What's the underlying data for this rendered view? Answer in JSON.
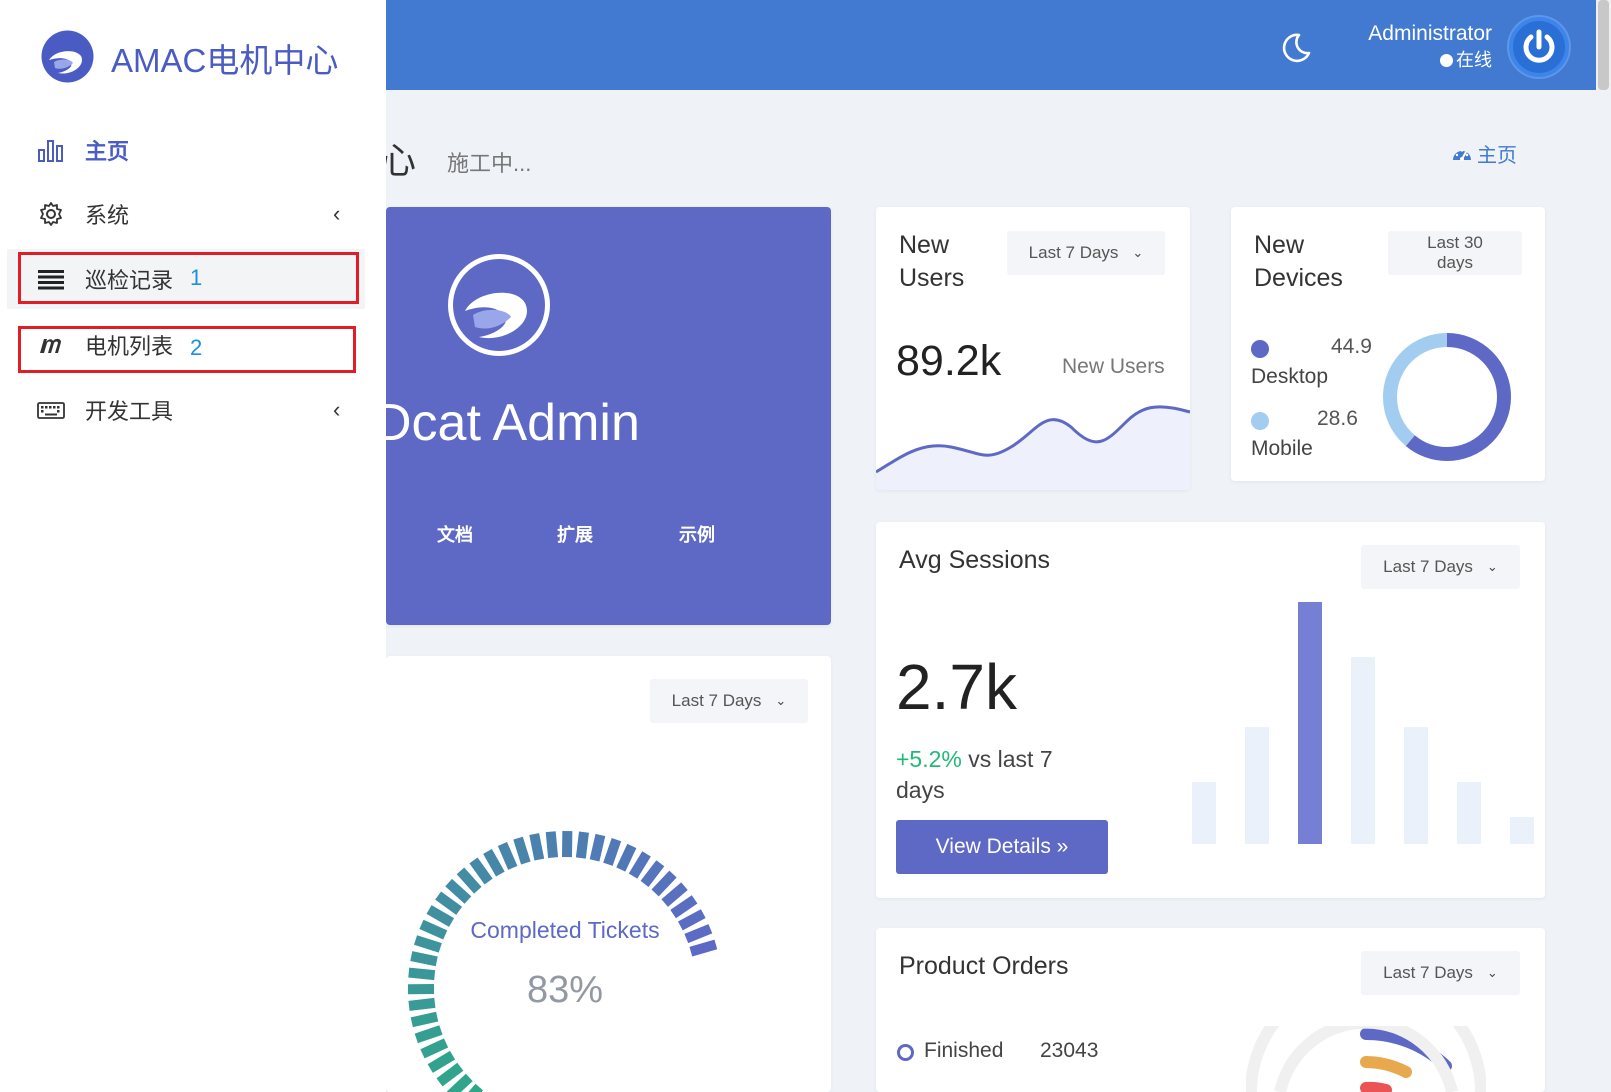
{
  "brand": {
    "name": "AMAC电机中心"
  },
  "header": {
    "user_name": "Administrator",
    "user_status": "在线"
  },
  "content": {
    "title": "心",
    "subtitle": "施工中...",
    "breadcrumb": "主页"
  },
  "sidebar": {
    "items": [
      {
        "label": "主页",
        "icon": "bar-chart-icon",
        "active": true
      },
      {
        "label": "系统",
        "icon": "gear-icon",
        "has_children": true
      },
      {
        "label": "巡检记录",
        "icon": "list-icon"
      },
      {
        "label": "电机列表",
        "icon": "m-icon"
      },
      {
        "label": "开发工具",
        "icon": "keyboard-icon",
        "has_children": true
      }
    ],
    "annotations": [
      "1",
      "2"
    ]
  },
  "hero": {
    "title": "Dcat Admin",
    "links": [
      "文档",
      "扩展",
      "示例"
    ]
  },
  "new_users": {
    "title": "New Users",
    "range": "Last 7 Days",
    "value": "89.2k",
    "caption": "New Users"
  },
  "new_devices": {
    "title": "New Devices",
    "range": "Last 30 days",
    "segments": [
      {
        "name": "Desktop",
        "value": 44.9,
        "color": "#5d69c5"
      },
      {
        "name": "Mobile",
        "value": 28.6,
        "color": "#a3cdf0"
      }
    ]
  },
  "avg_sessions": {
    "title": "Avg Sessions",
    "range": "Last 7 Days",
    "value": "2.7k",
    "delta": "+5.2%",
    "delta_text": "vs last 7 days",
    "button": "View Details »"
  },
  "tickets": {
    "range": "Last 7 Days",
    "label": "Completed Tickets",
    "value": "83%",
    "percent": 83
  },
  "product_orders": {
    "title": "Product Orders",
    "range": "Last 7 Days",
    "legend": [
      {
        "name": "Finished",
        "value": "23043"
      }
    ]
  },
  "colors": {
    "primary": "#5d69c5",
    "header": "#4279d1",
    "success": "#21b978",
    "annotation": "#e11d26",
    "annotation_number": "#1b8fe0"
  }
}
